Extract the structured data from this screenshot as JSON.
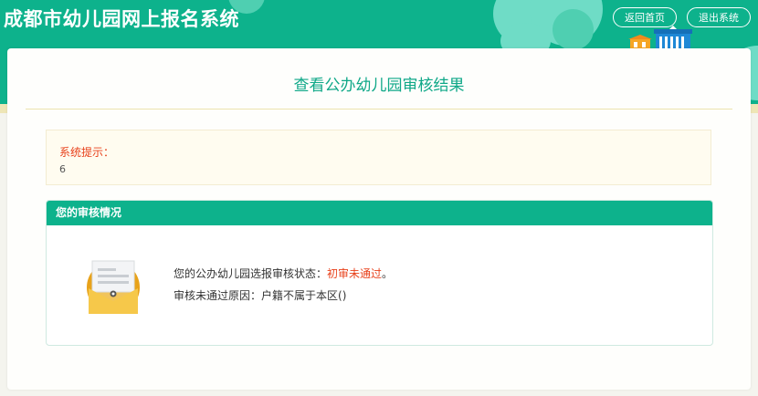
{
  "header": {
    "title": "成都市幼儿园网上报名系统",
    "home_button": "返回首页",
    "exit_button": "退出系统"
  },
  "page": {
    "title": "查看公办幼儿园审核结果"
  },
  "notice": {
    "label": "系统提示：",
    "value": "6"
  },
  "review": {
    "heading": "您的审核情况",
    "status_label": "您的公办幼儿园选报审核状态：",
    "status_value": "初审未通过",
    "status_suffix": "。",
    "reason_label": "审核未通过原因：",
    "reason_value": "户籍不属于本区()"
  },
  "colors": {
    "brand": "#0db28c",
    "alert": "#e8411b",
    "title_text": "#0fa888"
  },
  "icons": {
    "envelope": "envelope-document-icon",
    "building": "building-icon"
  }
}
